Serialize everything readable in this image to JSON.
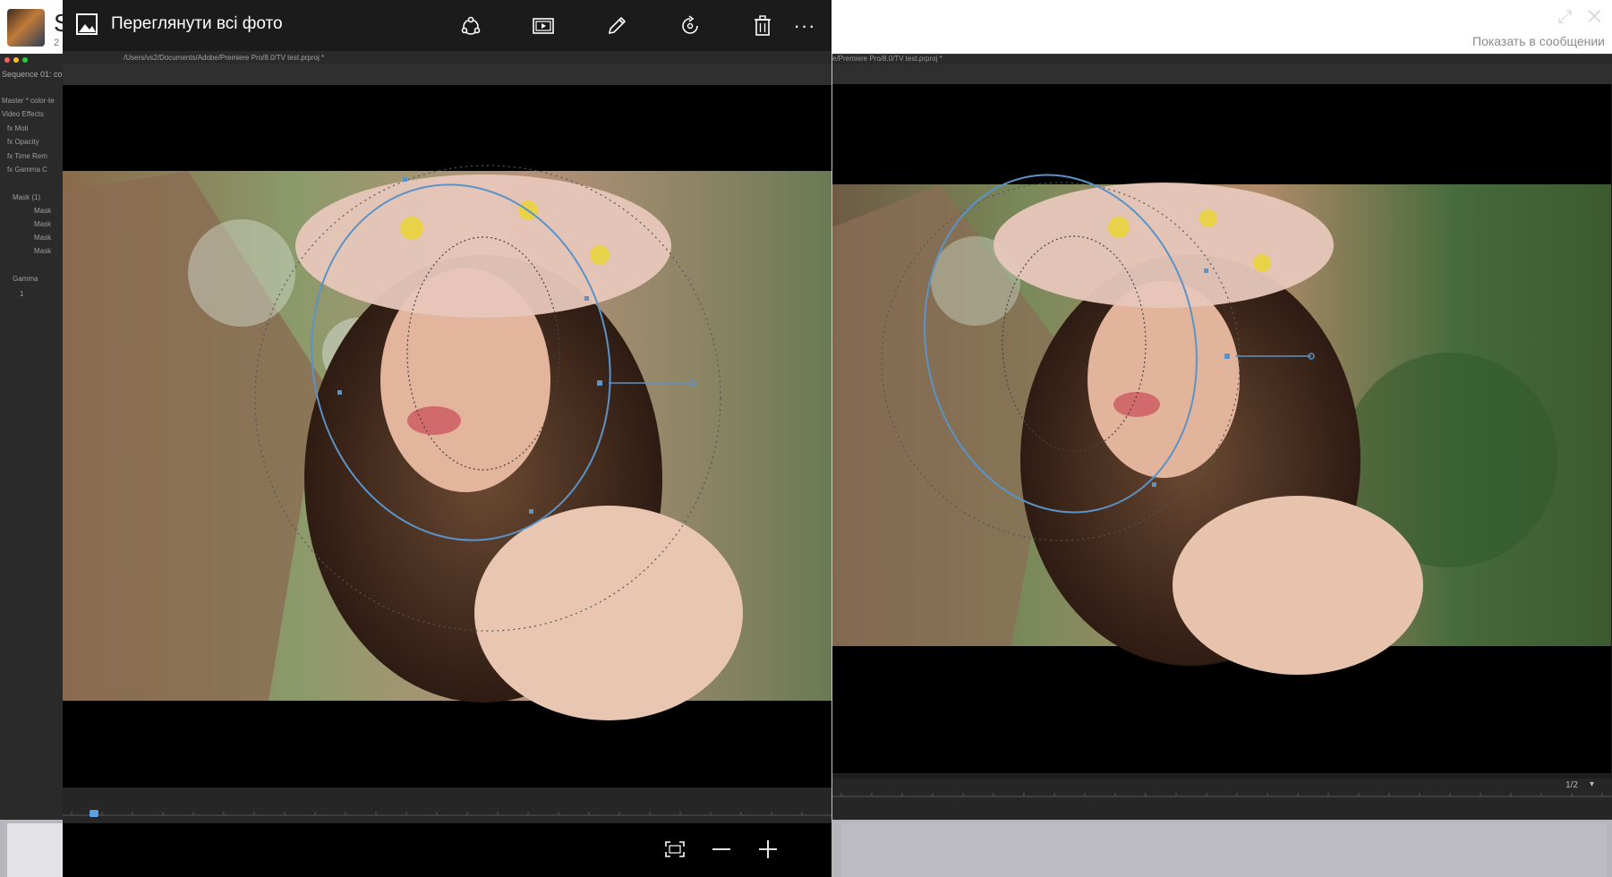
{
  "background_app": {
    "title_letter": "S",
    "subtitle": "2",
    "show_in_message": "Показать в сообщении",
    "window_icons": "⤢ ✕"
  },
  "premiere_right": {
    "path": "e/Premiere Pro/8.0/TV test.prproj *",
    "page_indicator": "1/2",
    "page_caret": "▾"
  },
  "premiere_left": {
    "sequence_label": "Sequence 01: co",
    "rows": [
      "Master * color-te",
      "Video Effects",
      "fx Moti",
      "fx Opacity",
      "fx Time Rem",
      "fx Gamma C",
      "Mask (1)",
      "Mask",
      "Mask",
      "Mask",
      "Mask",
      "Gamma",
      "1"
    ]
  },
  "viewer": {
    "title": "Переглянути всі фото",
    "path": "/Users/vs2/Documents/Adobe/Premiere Pro/8.0/TV test.prproj *",
    "toolbar_icons": [
      "share-icon",
      "slideshow-icon",
      "edit-pencil-icon",
      "rotate-icon",
      "delete-icon",
      "more-icon"
    ],
    "more_label": "···",
    "bottom_icons": [
      "fit-to-window-icon",
      "zoom-out-icon",
      "zoom-in-icon"
    ]
  },
  "colors": {
    "viewer_toolbar": "#1b1b1b",
    "mask_stroke": "#5b93c7",
    "premiere_panel": "#1e1e1e",
    "bottom_strip": "#b7b6bd"
  }
}
